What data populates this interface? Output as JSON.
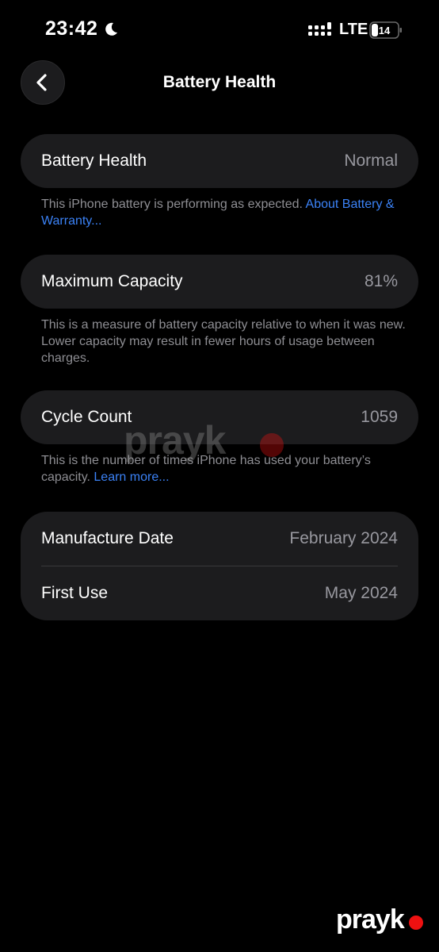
{
  "status_bar": {
    "time": "23:42",
    "network": "LTE",
    "battery_level": "14"
  },
  "nav": {
    "title": "Battery Health"
  },
  "battery_health": {
    "label": "Battery Health",
    "value": "Normal",
    "footnote_text": "This iPhone battery is performing as expected. ",
    "footnote_link": "About Battery & Warranty..."
  },
  "max_capacity": {
    "label": "Maximum Capacity",
    "value": "81%",
    "footnote_text": "This is a measure of battery capacity relative to when it was new. Lower capacity may result in fewer hours of usage between charges."
  },
  "cycle_count": {
    "label": "Cycle Count",
    "value": "1059",
    "footnote_text": "This is the number of times iPhone has used your battery’s capacity. ",
    "footnote_link": "Learn more..."
  },
  "dates": {
    "manufacture_label": "Manufacture Date",
    "manufacture_value": "February 2024",
    "first_use_label": "First Use",
    "first_use_value": "May 2024"
  },
  "watermark": {
    "text": "prayk"
  },
  "colors": {
    "background": "#000000",
    "card": "#1c1c1e",
    "link": "#3b82f6",
    "secondary_text": "#98989f"
  }
}
